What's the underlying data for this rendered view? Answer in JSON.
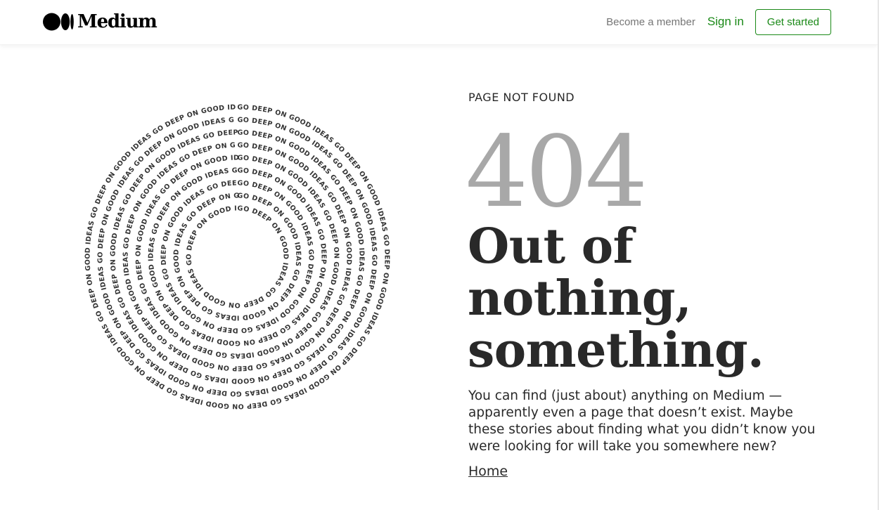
{
  "header": {
    "logo_text": "Medium",
    "nav": {
      "become_member": "Become a member",
      "sign_in": "Sign in",
      "get_started": "Get started"
    }
  },
  "illustration": {
    "repeated_text": "GO DEEP ON GOOD IDEAS"
  },
  "main": {
    "kicker": "PAGE NOT FOUND",
    "code": "404",
    "headline_line1": "Out of nothing,",
    "headline_line2": "something.",
    "body": "You can find (just about) anything on Medium — apparently even a page that doesn’t exist. Maybe these stories about finding what you didn’t know you were looking for will take you somewhere new?",
    "home_link": "Home"
  },
  "colors": {
    "brand_green": "#1a8917",
    "text_dark": "#292929",
    "text_muted": "#757575",
    "code_gray": "#a8a8a8"
  }
}
